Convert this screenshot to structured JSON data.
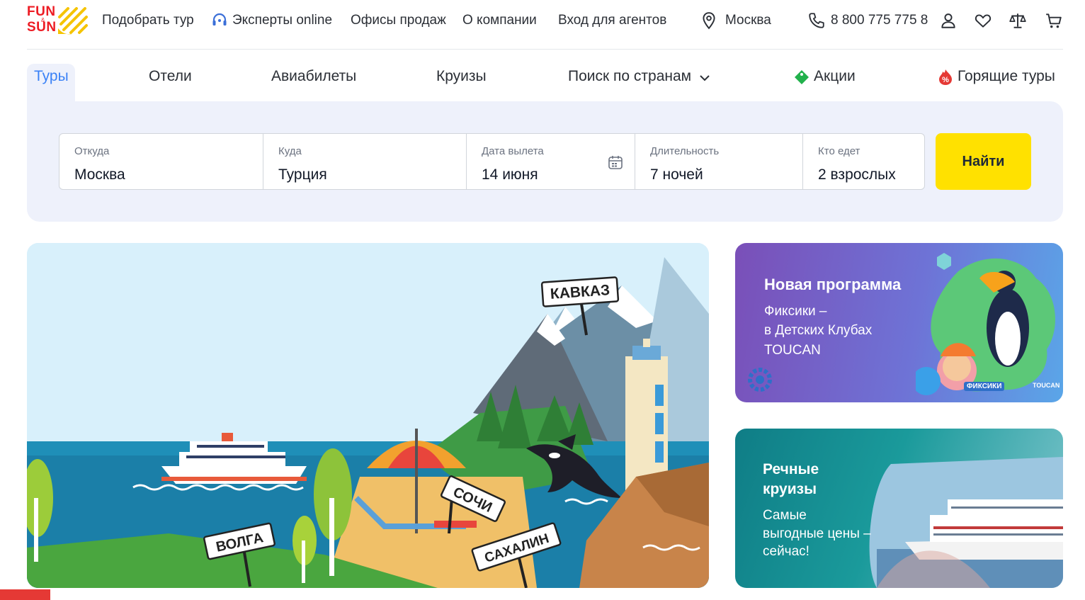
{
  "header": {
    "logo_top": "FUN",
    "logo_amp": "&",
    "logo_bottom": "SUN",
    "nav": {
      "pick_tour": "Подобрать тур",
      "experts": "Эксперты online",
      "offices": "Офисы продаж",
      "about": "О компании",
      "agents": "Вход для агентов"
    },
    "city": "Москва",
    "phone": "8 800 775 775 8",
    "icons": [
      "headset-icon",
      "location-pin-icon",
      "phone-icon",
      "user-icon",
      "heart-icon",
      "scales-icon",
      "cart-icon"
    ]
  },
  "tabs": {
    "tours": "Туры",
    "hotels": "Отели",
    "flights": "Авиабилеты",
    "cruises": "Круизы",
    "countries": "Поиск по странам",
    "promos": "Акции",
    "hot": "Горящие туры"
  },
  "search": {
    "from_label": "Откуда",
    "from_value": "Москва",
    "to_label": "Куда",
    "to_value": "Турция",
    "date_label": "Дата вылета",
    "date_value": "14 июня",
    "duration_label": "Длительность",
    "duration_value": "7 ночей",
    "who_label": "Кто едет",
    "who_value": "2 взрослых",
    "find_button": "Найти"
  },
  "main_banner": {
    "signs": {
      "caucasus": "КАВКАЗ",
      "sochi": "СОЧИ",
      "volga": "ВОЛГА",
      "sakhalin": "САХАЛИН"
    }
  },
  "banner_fixiki": {
    "title": "Новая программа",
    "text_line1": "Фиксики –",
    "text_line2": "в Детских Клубах",
    "text_line3": "TOUCAN",
    "logo_small": "ФИКСИКИ",
    "logo_toucan": "TOUCAN"
  },
  "banner_river": {
    "title_line1": "Речные",
    "title_line2": "круизы",
    "text_line1": "Самые",
    "text_line2": "выгодные цены –",
    "text_line3": "сейчас!"
  },
  "colors": {
    "accent_yellow": "#ffe100",
    "active_tab_blue": "#3b82f6",
    "panel_bg": "#eef1fb",
    "brand_red": "#ed1c24"
  }
}
